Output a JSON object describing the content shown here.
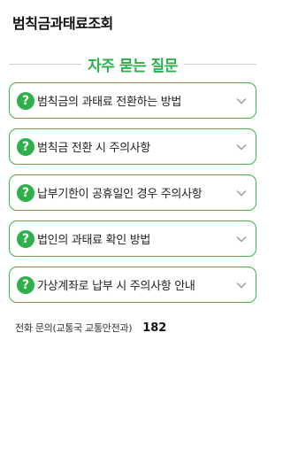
{
  "app": {
    "title": "범칙금과태료조회"
  },
  "faq": {
    "heading": "자주 묻는 질문",
    "badge": "?",
    "items": [
      {
        "label": "범칙금의 과태료 전환하는 방법"
      },
      {
        "label": "범칙금 전환 시 주의사항"
      },
      {
        "label": "납부기한이 공휴일인 경우 주의사항"
      },
      {
        "label": "법인의 과태료 확인 방법"
      },
      {
        "label": "가상계좌로 납부 시 주의사항 안내"
      }
    ]
  },
  "contact": {
    "label": "전화 문의(교통국 교통안전과)",
    "number": "182"
  },
  "colors": {
    "accent": "#2bb24c",
    "border": "#39b54a",
    "chevron": "#9a9a9a"
  },
  "icons": {
    "badge": "question-icon",
    "expand": "chevron-down-icon"
  }
}
